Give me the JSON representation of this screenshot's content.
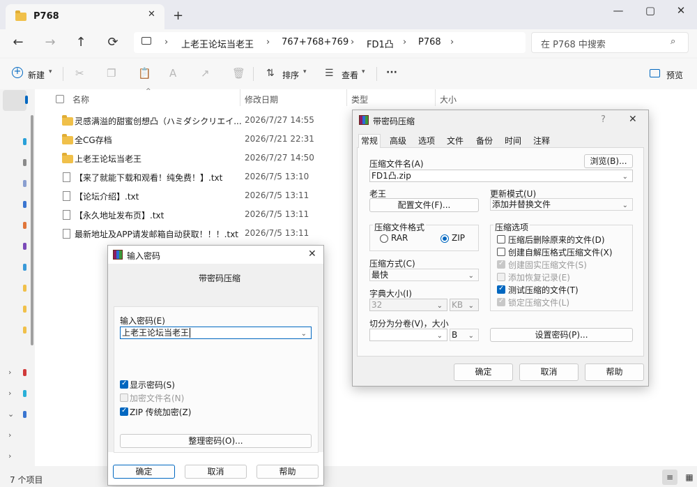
{
  "window": {
    "tab_title": "P768",
    "tab_close": "✕",
    "new_tab": "+",
    "minimize": "—",
    "maximize": "▢",
    "close": "✕"
  },
  "nav": {
    "back": "←",
    "forward": "→",
    "up": "↑",
    "refresh": "⟳",
    "breadcrumbs": [
      "上老王论坛当老王",
      "767+768+769",
      "FD1凸",
      "P768"
    ],
    "search_placeholder": "在 P768 中搜索"
  },
  "toolbar": {
    "new_label": "新建",
    "sort_label": "排序",
    "view_label": "查看",
    "more": "···",
    "preview_label": "预览"
  },
  "columns": {
    "name": "名称",
    "modified": "修改日期",
    "type": "类型",
    "size": "大小"
  },
  "files": [
    {
      "name": "灵感满溢的甜蜜创想凸（ハミダシクリエイ...",
      "modified": "2026/7/27 14:55",
      "kind": "folder"
    },
    {
      "name": "全CG存档",
      "modified": "2026/7/21 22:31",
      "kind": "folder"
    },
    {
      "name": "上老王论坛当老王",
      "modified": "2026/7/27 14:50",
      "kind": "folder"
    },
    {
      "name": "【来了就能下载和观看！纯免费！】.txt",
      "modified": "2026/7/5 13:10",
      "kind": "file"
    },
    {
      "name": "【论坛介绍】.txt",
      "modified": "2026/7/5 13:11",
      "kind": "file"
    },
    {
      "name": "【永久地址发布页】.txt",
      "modified": "2026/7/5 13:11",
      "kind": "file"
    },
    {
      "name": "最新地址及APP请发邮箱自动获取！！！.txt",
      "modified": "2026/7/5 13:11",
      "kind": "file"
    }
  ],
  "status": {
    "item_count": "7 个项目"
  },
  "archive_dialog": {
    "title": "带密码压缩",
    "help": "?",
    "close": "✕",
    "tabs": [
      "常规",
      "高级",
      "选项",
      "文件",
      "备份",
      "时间",
      "注释"
    ],
    "archive_name_label": "压缩文件名(A)",
    "browse_button": "浏览(B)...",
    "archive_name_value": "FD1凸.zip",
    "profile_label": "老王",
    "profile_button": "配置文件(F)...",
    "update_mode_label": "更新模式(U)",
    "update_mode_value": "添加并替换文件",
    "format_group_label": "压缩文件格式",
    "format_rar": "RAR",
    "format_zip": "ZIP",
    "method_label": "压缩方式(C)",
    "method_value": "最快",
    "dict_label": "字典大小(I)",
    "dict_value": "32",
    "dict_unit": "KB",
    "split_label": "切分为分卷(V)，大小",
    "split_unit": "B",
    "options_group_label": "压缩选项",
    "options": [
      {
        "label": "压缩后删除原来的文件(D)",
        "checked": false,
        "disabled": false
      },
      {
        "label": "创建自解压格式压缩文件(X)",
        "checked": false,
        "disabled": false
      },
      {
        "label": "创建固实压缩文件(S)",
        "checked": true,
        "disabled": true
      },
      {
        "label": "添加恢复记录(E)",
        "checked": false,
        "disabled": true
      },
      {
        "label": "测试压缩的文件(T)",
        "checked": true,
        "disabled": false
      },
      {
        "label": "锁定压缩文件(L)",
        "checked": true,
        "disabled": true
      }
    ],
    "set_password_button": "设置密码(P)...",
    "ok_button": "确定",
    "cancel_button": "取消",
    "help_button": "帮助"
  },
  "password_dialog": {
    "title": "输入密码",
    "close": "✕",
    "subtitle": "带密码压缩",
    "password_label": "输入密码(E)",
    "password_value": "上老王论坛当老王",
    "show_password": "显示密码(S)",
    "encrypt_names": "加密文件名(N)",
    "zip_legacy": "ZIP 传统加密(Z)",
    "organize_button": "整理密码(O)...",
    "ok_button": "确定",
    "cancel_button": "取消",
    "help_button": "帮助"
  }
}
